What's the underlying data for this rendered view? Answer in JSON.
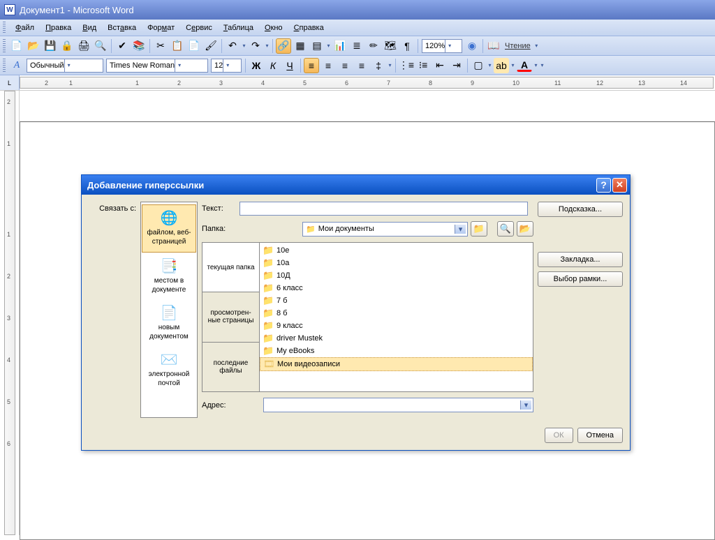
{
  "title": "Документ1 - Microsoft Word",
  "menu": [
    "Файл",
    "Правка",
    "Вид",
    "Вставка",
    "Формат",
    "Сервис",
    "Таблица",
    "Окно",
    "Справка"
  ],
  "toolbar1": {
    "zoom": "120%",
    "read": "Чтение"
  },
  "toolbar2": {
    "style": "Обычный",
    "font": "Times New Roman",
    "size": "12"
  },
  "dialog": {
    "title": "Добавление гиперссылки",
    "link_with": "Связать с:",
    "linkto": [
      {
        "label": "файлом, веб-страницей"
      },
      {
        "label": "местом в документе"
      },
      {
        "label": "новым документом"
      },
      {
        "label": "электронной почтой"
      }
    ],
    "text_label": "Текст:",
    "text_value": "",
    "hint_btn": "Подсказка...",
    "folder_label": "Папка:",
    "folder_value": "Мои документы",
    "bookmark_btn": "Закладка...",
    "frame_btn": "Выбор рамки...",
    "vtabs": [
      "текущая папка",
      "просмотрен-ные страницы",
      "последние файлы"
    ],
    "files": [
      "10е",
      "10а",
      "10Д",
      "6 класс",
      "7 б",
      "8 б",
      "9 класс",
      "driver Mustek",
      "My eBooks",
      "Мои видеозаписи"
    ],
    "address_label": "Адрес:",
    "address_value": "",
    "ok": "ОК",
    "cancel": "Отмена"
  }
}
